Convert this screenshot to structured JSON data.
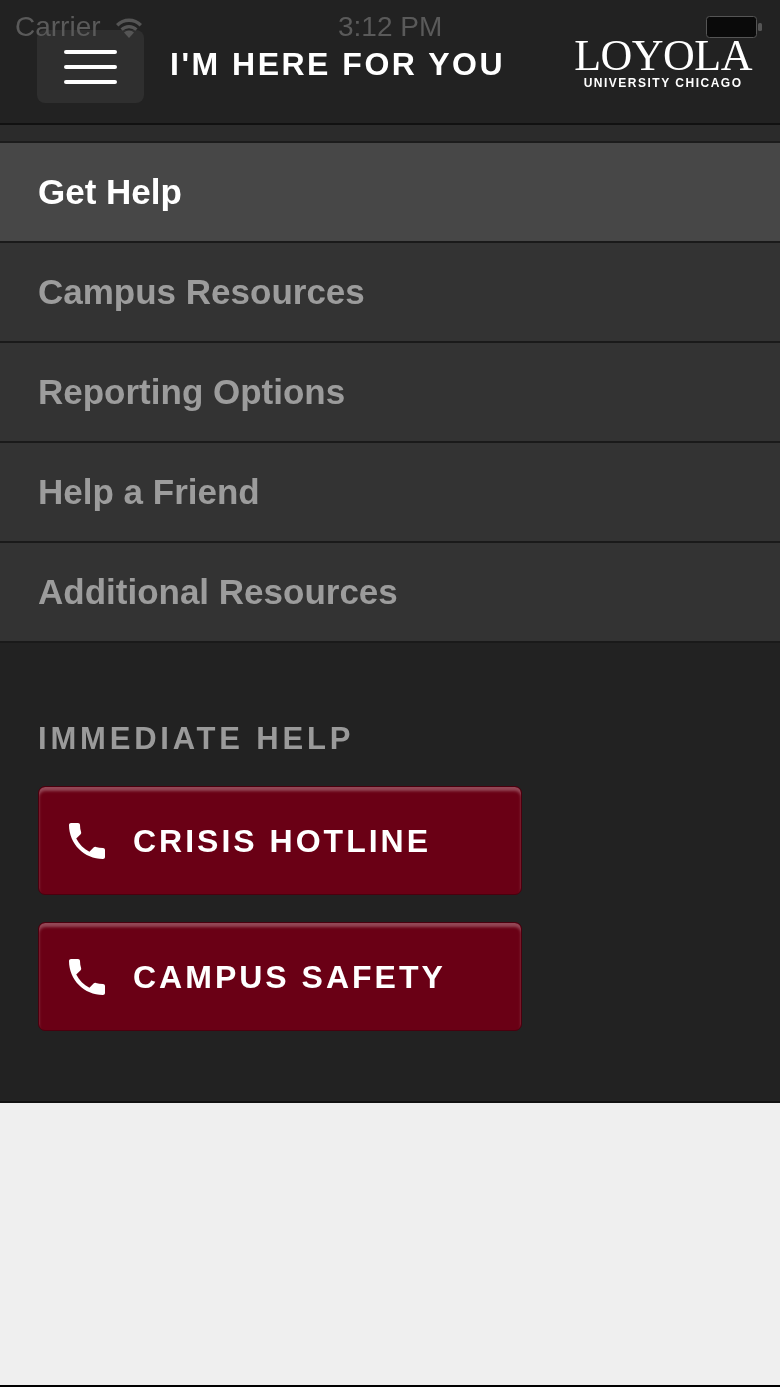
{
  "status_bar": {
    "carrier": "Carrier",
    "time": "3:12 PM"
  },
  "header": {
    "title": "I'M HERE FOR YOU",
    "logo": {
      "name": "LOYOLA",
      "subtitle": "UNIVERSITY CHICAGO"
    }
  },
  "menu": {
    "items": [
      {
        "label": "Get Help",
        "selected": true
      },
      {
        "label": "Campus Resources",
        "selected": false
      },
      {
        "label": "Reporting Options",
        "selected": false
      },
      {
        "label": "Help a Friend",
        "selected": false
      },
      {
        "label": "Additional Resources",
        "selected": false
      }
    ]
  },
  "immediate_help": {
    "heading": "IMMEDIATE HELP",
    "buttons": [
      {
        "label": "CRISIS HOTLINE"
      },
      {
        "label": "CAMPUS SAFETY"
      }
    ]
  }
}
